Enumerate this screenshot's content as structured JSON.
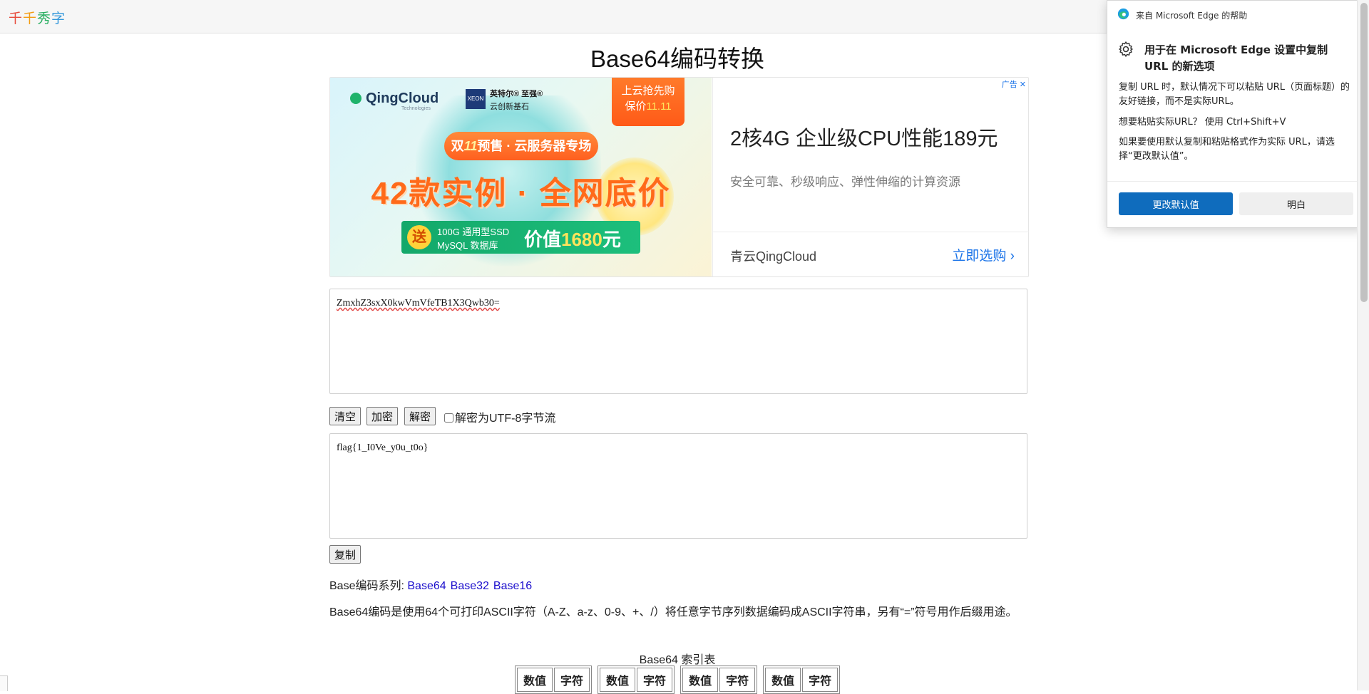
{
  "site": {
    "logo_chars": [
      "千",
      "千",
      "秀",
      "字"
    ],
    "logo_colors": [
      "#e74c3c",
      "#f39c12",
      "#27ae60",
      "#3498db"
    ]
  },
  "page": {
    "title": "Base64编码转换"
  },
  "ad": {
    "brand_logo": "QingCloud",
    "brand_logo_sub": "Technologies",
    "intel_badge": "XEON",
    "intel_line1": "英特尔® 至强®",
    "intel_line2": "云创新基石",
    "promo_tag_line1": "上云抢先购",
    "promo_tag_line2_prefix": "保价",
    "promo_tag_date": "11.11",
    "pill_prefix": "双",
    "pill_num": "11",
    "pill_suffix": "预售 · 云服务器专场",
    "headline": "42款实例 · 全网底价",
    "gift_badge": "送",
    "gift_line1": "100G 通用型SSD",
    "gift_line2": "MySQL 数据库",
    "gift_value_prefix": "价值",
    "gift_value_num": "1680",
    "gift_value_suffix": "元",
    "badge": "广告",
    "heading": "2核4G 企业级CPU性能189元",
    "description": "安全可靠、秒级响应、弹性伸缩的计算资源",
    "brand": "青云QingCloud",
    "cta": "立即选购"
  },
  "input_text": "ZmxhZ3sxX0kwVmVfeTB1X3Qwb30=",
  "output_text": "flag{1_I0Ve_y0u_t0o}",
  "toolbar": {
    "clear_label": "清空",
    "encode_label": "加密",
    "decode_label": "解密",
    "utf8_checkbox_label": "解密为UTF-8字节流",
    "utf8_checked": false
  },
  "copy_label": "复制",
  "series": {
    "label": "Base编码系列:",
    "links": [
      "Base64",
      "Base32",
      "Base16"
    ]
  },
  "description": "Base64编码是使用64个可打印ASCII字符（A-Z、a-z、0-9、+、/）将任意字节序列数据编码成ASCII字符串，另有“=”符号用作后缀用途。",
  "index_table": {
    "caption": "Base64 索引表",
    "headers": [
      "数值",
      "字符"
    ]
  },
  "popup": {
    "source": "来自 Microsoft Edge 的帮助",
    "title": "用于在 Microsoft Edge 设置中复制 URL 的新选项",
    "para1": "复制 URL 时，默认情况下可以粘贴 URL（页面标题）的友好链接，而不是实际URL。",
    "para2": "想要粘贴实际URL？ 使用 Ctrl+Shift+V",
    "para3": "如果要使用默认复制和粘贴格式作为实际 URL，请选择“更改默认值”。",
    "primary_button": "更改默认值",
    "secondary_button": "明白"
  },
  "colors": {
    "link": "#1a0dcc",
    "edge_blue": "#0f6cbd",
    "ad_link": "#1a73e8",
    "ad_orange": "#ff6a1a",
    "ad_green": "#13a86a"
  }
}
